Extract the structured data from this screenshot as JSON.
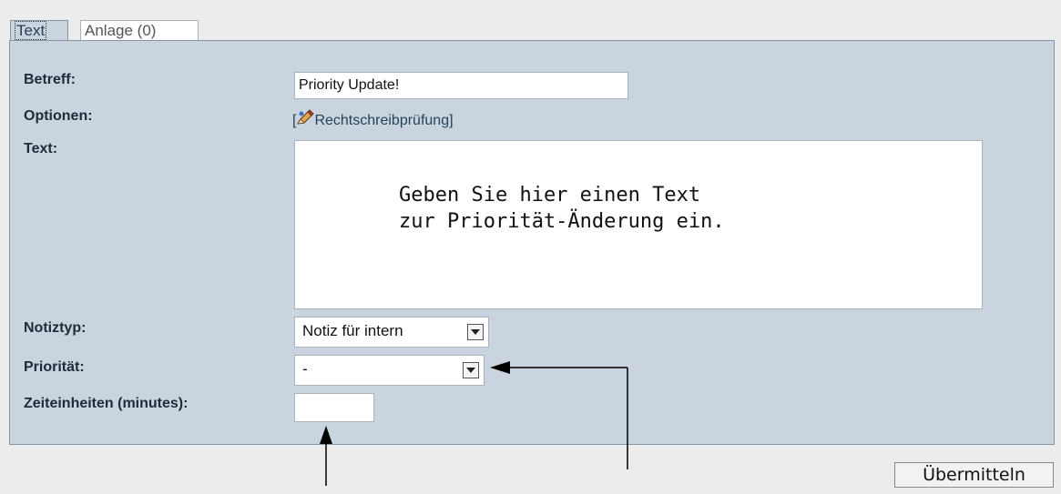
{
  "tabs": [
    {
      "label": "Text",
      "active": true
    },
    {
      "label": "Anlage (0)",
      "active": false
    }
  ],
  "form": {
    "subject_label": "Betreff:",
    "subject_value": "Priority Update!",
    "options_label": "Optionen:",
    "spellcheck_open_bracket": "[",
    "spellcheck_link": "Rechtschreibprüfung",
    "spellcheck_close_bracket": "]",
    "text_label": "Text:",
    "text_line_1": "Geben Sie hier einen Text",
    "text_line_2": "zur Priorität-Änderung ein.",
    "notetype_label": "Notiztyp:",
    "notetype_value": "Notiz für intern",
    "priority_label": "Priorität:",
    "priority_value": "-",
    "time_units_label": "Zeiteinheiten (minutes):",
    "time_units_value": ""
  },
  "submit_label": "Übermitteln",
  "colors": {
    "panel_bg": "#c9d4de",
    "panel_border": "#8797a6",
    "link": "#24445c"
  },
  "icons": {
    "spellcheck": "pencil-icon",
    "dropdown": "chevron-down-icon",
    "annotation": "arrow-icon"
  }
}
